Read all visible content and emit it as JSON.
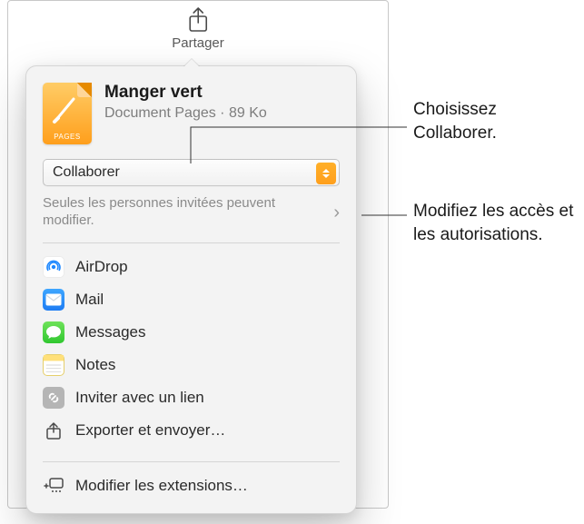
{
  "toolbar": {
    "share_label": "Partager"
  },
  "document": {
    "title": "Manger vert",
    "subtitle": "Document Pages · 89 Ko",
    "icon_label": "PAGES"
  },
  "mode_dropdown": {
    "selected": "Collaborer"
  },
  "permissions": {
    "text": "Seules les personnes invitées peuvent modifier."
  },
  "share_options": [
    {
      "label": "AirDrop",
      "icon": "airdrop-icon"
    },
    {
      "label": "Mail",
      "icon": "mail-icon"
    },
    {
      "label": "Messages",
      "icon": "messages-icon"
    },
    {
      "label": "Notes",
      "icon": "notes-icon"
    },
    {
      "label": "Inviter avec un lien",
      "icon": "link-icon"
    },
    {
      "label": "Exporter et envoyer…",
      "icon": "export-icon"
    }
  ],
  "extensions": {
    "label": "Modifier les extensions…"
  },
  "callouts": {
    "choose": "Choisissez Collaborer.",
    "modify": "Modifiez les accès et les autorisations."
  }
}
